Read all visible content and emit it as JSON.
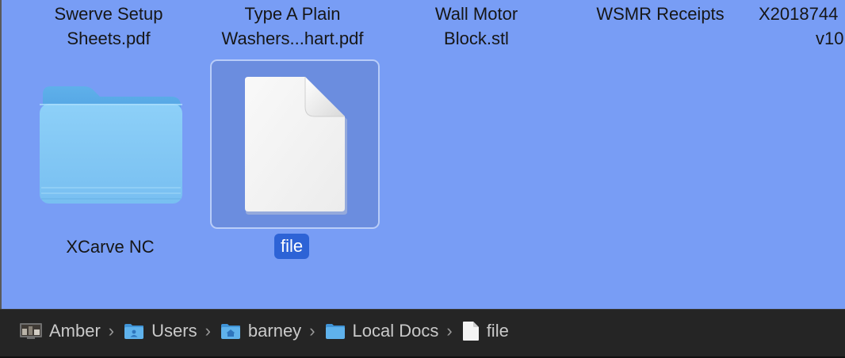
{
  "top_row": [
    {
      "line1": "Swerve Setup",
      "line2": "Sheets.pdf"
    },
    {
      "line1": "Type A Plain",
      "line2": "Washers...hart.pdf"
    },
    {
      "line1": "Wall Motor",
      "line2": "Block.stl"
    },
    {
      "line1": "WSMR Receipts",
      "line2": ""
    },
    {
      "line1": "X2018744",
      "line2": "v10"
    }
  ],
  "items": [
    {
      "label": "XCarve NC",
      "icon": "folder-icon"
    },
    {
      "label": "file",
      "icon": "document-icon",
      "selected": true
    }
  ],
  "path_bar": {
    "crumbs": [
      {
        "label": "Amber",
        "icon": "computer-icon"
      },
      {
        "label": "Users",
        "icon": "users-folder-icon"
      },
      {
        "label": "barney",
        "icon": "home-folder-icon"
      },
      {
        "label": "Local Docs",
        "icon": "folder-icon"
      },
      {
        "label": "file",
        "icon": "document-icon"
      }
    ],
    "separator": "›"
  },
  "colors": {
    "background": "#789df5",
    "selection": "#6b8ddf",
    "label_selected": "#2d63d6",
    "folder": "#84c8f5",
    "path_bar": "#252525"
  }
}
